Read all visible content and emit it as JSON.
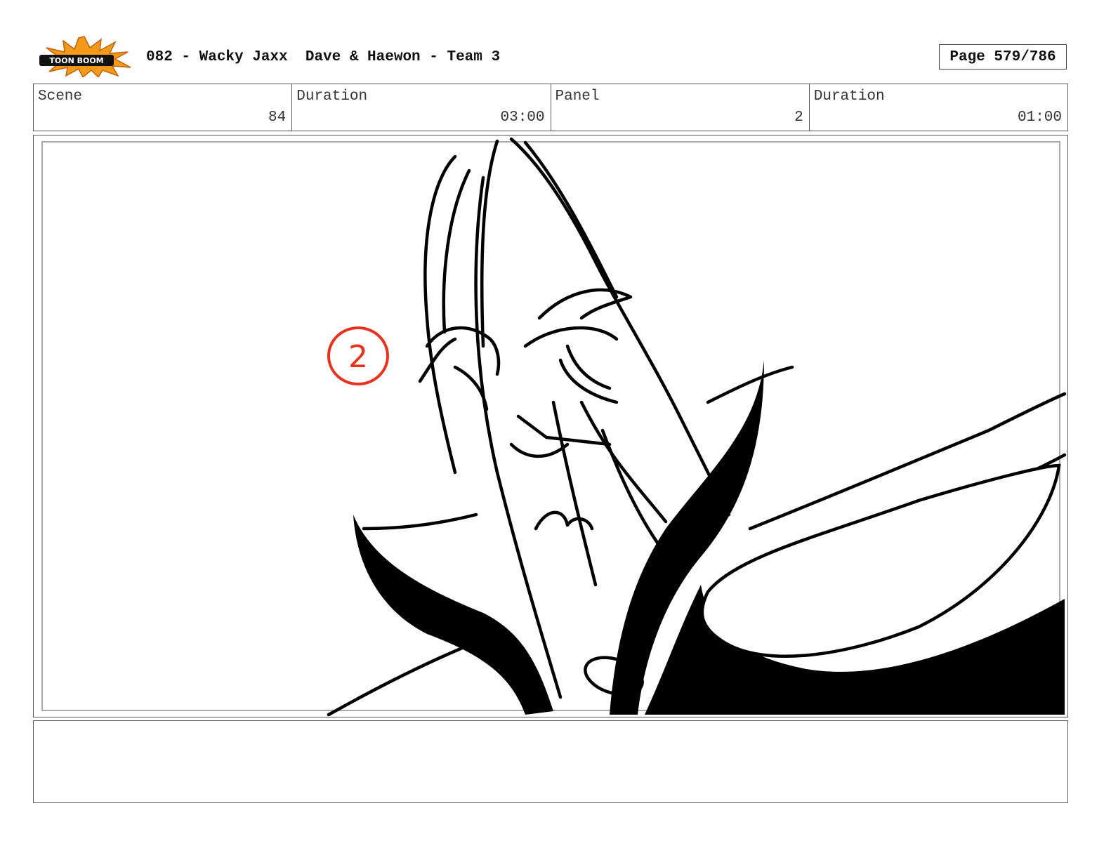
{
  "header": {
    "logo_text": "TOON BOOM",
    "title": "082 - Wacky Jaxx  Dave & Haewon - Team 3",
    "page": "Page 579/786"
  },
  "info": {
    "scene_label": "Scene",
    "scene_value": "84",
    "duration_label": "Duration",
    "duration_value": "03:00",
    "panel_label": "Panel",
    "panel_value": "2",
    "panel_duration_label": "Duration",
    "panel_duration_value": "01:00"
  },
  "panel": {
    "marker": "2",
    "marker_color": "#e8321e"
  },
  "notes": {
    "text": ""
  }
}
